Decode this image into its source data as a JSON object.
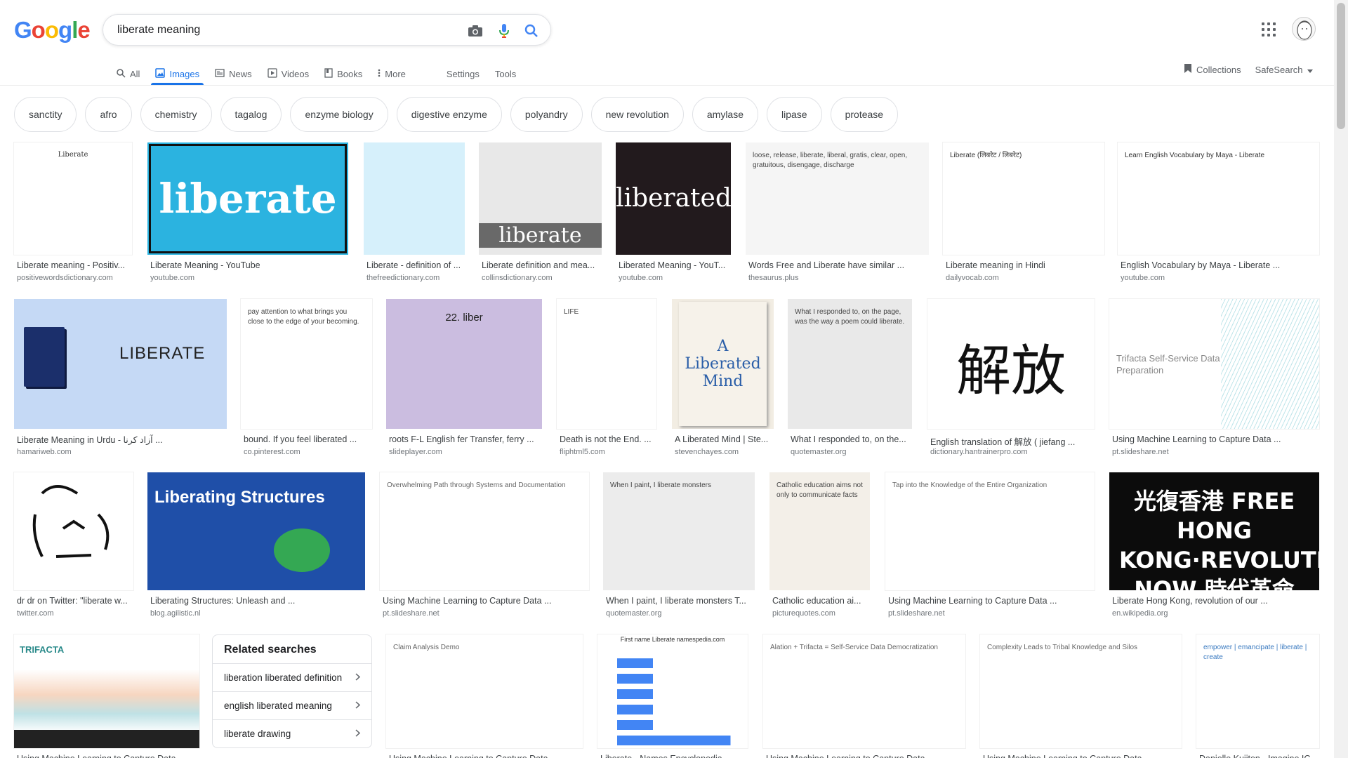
{
  "header": {
    "logo_letters": [
      {
        "ch": "G",
        "color": "#4285F4"
      },
      {
        "ch": "o",
        "color": "#EA4335"
      },
      {
        "ch": "o",
        "color": "#FBBC05"
      },
      {
        "ch": "g",
        "color": "#4285F4"
      },
      {
        "ch": "l",
        "color": "#34A853"
      },
      {
        "ch": "e",
        "color": "#EA4335"
      }
    ],
    "search_value": "liberate meaning",
    "icons": [
      "camera-icon",
      "mic-icon",
      "search-icon",
      "apps-icon"
    ]
  },
  "tabs": [
    {
      "label": "All",
      "icon": "search-icon",
      "active": false
    },
    {
      "label": "Images",
      "icon": "image-icon",
      "active": true
    },
    {
      "label": "News",
      "icon": "news-icon",
      "active": false
    },
    {
      "label": "Videos",
      "icon": "video-icon",
      "active": false
    },
    {
      "label": "Books",
      "icon": "book-icon",
      "active": false
    },
    {
      "label": "More",
      "icon": "more-icon",
      "active": false
    }
  ],
  "tools": {
    "settings": "Settings",
    "tools": "Tools"
  },
  "header_right": {
    "collections": "Collections",
    "safesearch": "SafeSearch"
  },
  "chips": [
    "sanctity",
    "afro",
    "chemistry",
    "tagalog",
    "enzyme biology",
    "digestive enzyme",
    "polyandry",
    "new revolution",
    "amylase",
    "lipase",
    "protease"
  ],
  "images": [
    {
      "caption": "Liberate meaning - Positiv...",
      "source": "positivewordsdictionary.com",
      "thumb_text": "Liberate",
      "bg": "#ffffff",
      "fg": "#333333"
    },
    {
      "caption": "Liberate Meaning - YouTube",
      "source": "youtube.com",
      "thumb_text": "liberate",
      "bg": "#2bb3e0",
      "fg": "#ffffff"
    },
    {
      "caption": "Liberate - definition of ...",
      "source": "thefreedictionary.com",
      "thumb_text": "",
      "bg": "#d6f0fb",
      "fg": "#333"
    },
    {
      "caption": "Liberate definition and mea...",
      "source": "collinsdictionary.com",
      "thumb_text": "liberate",
      "bg": "#e8e8e8",
      "fg": "#ffffff"
    },
    {
      "caption": "Liberated Meaning - YouT...",
      "source": "youtube.com",
      "thumb_text": "liberated",
      "bg": "#221a1d",
      "fg": "#ffffff"
    },
    {
      "caption": "Words Free and Liberate have similar ...",
      "source": "thesaurus.plus",
      "thumb_text": "loose, release, liberate, liberal, gratis, clear, open, gratuitous, disengage, discharge",
      "bg": "#f5f5f5",
      "fg": "#444"
    },
    {
      "caption": "Liberate meaning in Hindi",
      "source": "dailyvocab.com",
      "thumb_text": "Liberate (लिबरेट / लिबरेट)",
      "bg": "#ffffff",
      "fg": "#333"
    },
    {
      "caption": "English Vocabulary by Maya - Liberate ...",
      "source": "youtube.com",
      "thumb_text": "Learn English Vocabulary by Maya - Liberate",
      "bg": "#ffffff",
      "fg": "#333"
    },
    {
      "caption": "Liberate Meaning in Urdu - آزاد کرنا ...",
      "source": "hamariweb.com",
      "thumb_text": "LIBERATE",
      "bg": "#c5d9f5",
      "fg": "#222"
    },
    {
      "caption": "bound. If you feel liberated ...",
      "source": "co.pinterest.com",
      "thumb_text": "pay attention to what brings you close to the edge of your becoming.",
      "bg": "#ffffff",
      "fg": "#444"
    },
    {
      "caption": "roots F-L English fer Transfer, ferry ...",
      "source": "slideplayer.com",
      "thumb_text": "22. liber",
      "bg": "#cbbde0",
      "fg": "#222"
    },
    {
      "caption": "Death is not the End. ...",
      "source": "fliphtml5.com",
      "thumb_text": "LIFE",
      "bg": "#ffffff",
      "fg": "#444"
    },
    {
      "caption": "A Liberated Mind | Ste...",
      "source": "stevenchayes.com",
      "thumb_text": "A Liberated Mind",
      "bg": "#f2ede3",
      "fg": "#2a5ea8"
    },
    {
      "caption": "What I responded to, on the...",
      "source": "quotemaster.org",
      "thumb_text": "What I responded to, on the page, was the way a poem could liberate.",
      "bg": "#e9e9e9",
      "fg": "#444"
    },
    {
      "caption": "English translation of 解放 ( jiefang ...",
      "source": "dictionary.hantrainerpro.com",
      "thumb_text": "解放",
      "bg": "#ffffff",
      "fg": "#111"
    },
    {
      "caption": "Using Machine Learning to Capture Data ...",
      "source": "pt.slideshare.net",
      "thumb_text": "Trifacta Self-Service Data Preparation",
      "bg": "#ffffff",
      "fg": "#888"
    },
    {
      "caption": "dr dr on Twitter: \"liberate w...",
      "source": "twitter.com",
      "thumb_text": "",
      "bg": "#ffffff",
      "fg": "#111"
    },
    {
      "caption": "Liberating Structures: Unleash and ...",
      "source": "blog.agilistic.nl",
      "thumb_text": "Liberating Structures",
      "bg": "#1f4fa8",
      "fg": "#ffffff"
    },
    {
      "caption": "Using Machine Learning to Capture Data ...",
      "source": "pt.slideshare.net",
      "thumb_text": "Overwhelming Path through Systems and Documentation",
      "bg": "#ffffff",
      "fg": "#666"
    },
    {
      "caption": "When I paint, I liberate monsters T...",
      "source": "quotemaster.org",
      "thumb_text": "When I paint, I liberate monsters",
      "bg": "#ececec",
      "fg": "#444"
    },
    {
      "caption": "Catholic education ai...",
      "source": "picturequotes.com",
      "thumb_text": "Catholic education aims not only to communicate facts",
      "bg": "#f3efe8",
      "fg": "#444"
    },
    {
      "caption": "Using Machine Learning to Capture Data ...",
      "source": "pt.slideshare.net",
      "thumb_text": "Tap into the Knowledge of the Entire Organization",
      "bg": "#ffffff",
      "fg": "#666"
    },
    {
      "caption": "Liberate Hong Kong, revolution of our ...",
      "source": "en.wikipedia.org",
      "thumb_text": "光復香港 FREE HONG KONG·REVOLUTION NOW 時代革命",
      "bg": "#0c0c0c",
      "fg": "#ffffff"
    },
    {
      "caption": "Using Machine Learning to Capture Data ...",
      "source": "",
      "thumb_text": "TRIFACTA",
      "bg": "#ffffff",
      "fg": "#333"
    },
    {
      "caption": "Using Machine Learning to Capture Data ...",
      "source": "",
      "thumb_text": "Claim Analysis Demo",
      "bg": "#ffffff",
      "fg": "#666"
    },
    {
      "caption": "Liberate - Names Encyclopedia",
      "source": "",
      "thumb_text": "First name Liberate namespedia.com",
      "bg": "#ffffff",
      "fg": "#333"
    },
    {
      "caption": "Using Machine Learning to Capture Data ...",
      "source": "",
      "thumb_text": "Alation + Trifacta = Self-Service Data Democratization",
      "bg": "#ffffff",
      "fg": "#666"
    },
    {
      "caption": "Using Machine Learning to Capture Data ...",
      "source": "",
      "thumb_text": "Complexity Leads to Tribal Knowledge and Silos",
      "bg": "#ffffff",
      "fg": "#666"
    },
    {
      "caption": "Danielle Kuijten - Imagine IC",
      "source": "",
      "thumb_text": "empower | emancipate | liberate | create",
      "bg": "#ffffff",
      "fg": "#3a7ac0"
    }
  ],
  "related": {
    "title": "Related searches",
    "items": [
      "liberation liberated definition",
      "english liberated meaning",
      "liberate drawing"
    ]
  }
}
